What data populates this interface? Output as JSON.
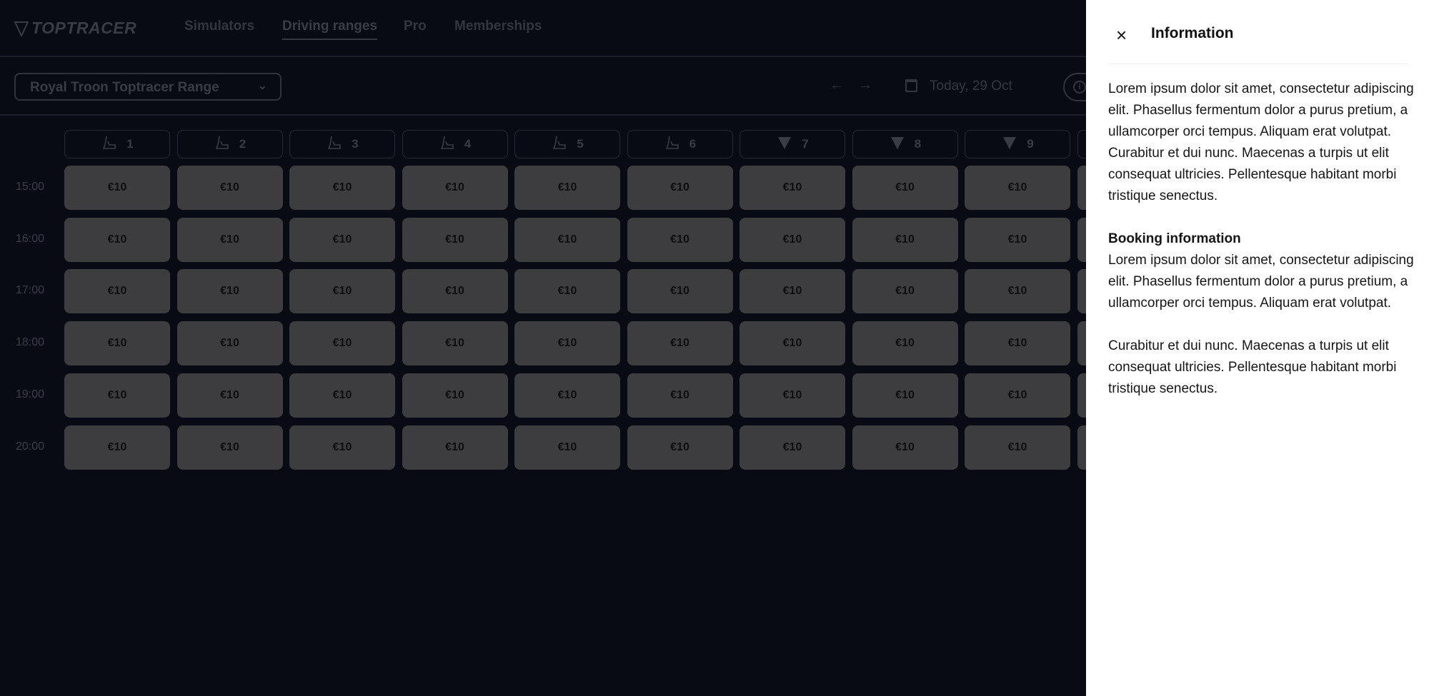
{
  "brand": {
    "logo": "TOPTRACER"
  },
  "nav": {
    "items": [
      {
        "label": "Simulators"
      },
      {
        "label": "Driving ranges",
        "active": true
      },
      {
        "label": "Pro"
      },
      {
        "label": "Memberships"
      }
    ]
  },
  "toolbar": {
    "venue": "Royal Troon Toptracer Range",
    "date": "Today, 29 Oct",
    "prev_icon": "arrow-left-icon",
    "next_icon": "arrow-right-icon",
    "info_icon": "info-icon"
  },
  "bays": [
    {
      "label": "1",
      "icon": "hitting-mat-icon"
    },
    {
      "label": "2",
      "icon": "hitting-mat-icon"
    },
    {
      "label": "3",
      "icon": "hitting-mat-icon"
    },
    {
      "label": "4",
      "icon": "hitting-mat-icon"
    },
    {
      "label": "5",
      "icon": "hitting-mat-icon"
    },
    {
      "label": "6",
      "icon": "hitting-mat-icon"
    },
    {
      "label": "7",
      "icon": "toptracer-shield-icon"
    },
    {
      "label": "8",
      "icon": "toptracer-shield-icon"
    },
    {
      "label": "9",
      "icon": "toptracer-shield-icon"
    }
  ],
  "times": [
    "15:00",
    "16:00",
    "17:00",
    "18:00",
    "19:00",
    "20:00"
  ],
  "price": "€10",
  "panel": {
    "title": "Information",
    "intro": "Lorem ipsum dolor sit amet, consectetur adipiscing elit. Phasellus fermentum dolor a purus pretium, a ullamcorper orci tempus. Aliquam erat volutpat. Curabitur et dui nunc. Maecenas a turpis ut elit consequat ultricies. Pellentesque habitant morbi tristique senectus.",
    "booking_heading": "Booking information",
    "booking_text": "Lorem ipsum dolor sit amet, consectetur adipiscing elit. Phasellus fermentum dolor a purus pretium, a ullamcorper orci tempus. Aliquam erat volutpat.",
    "extra_text": "Curabitur et dui nunc. Maecenas a turpis ut elit consequat ultricies. Pellentesque habitant morbi tristique senectus."
  }
}
